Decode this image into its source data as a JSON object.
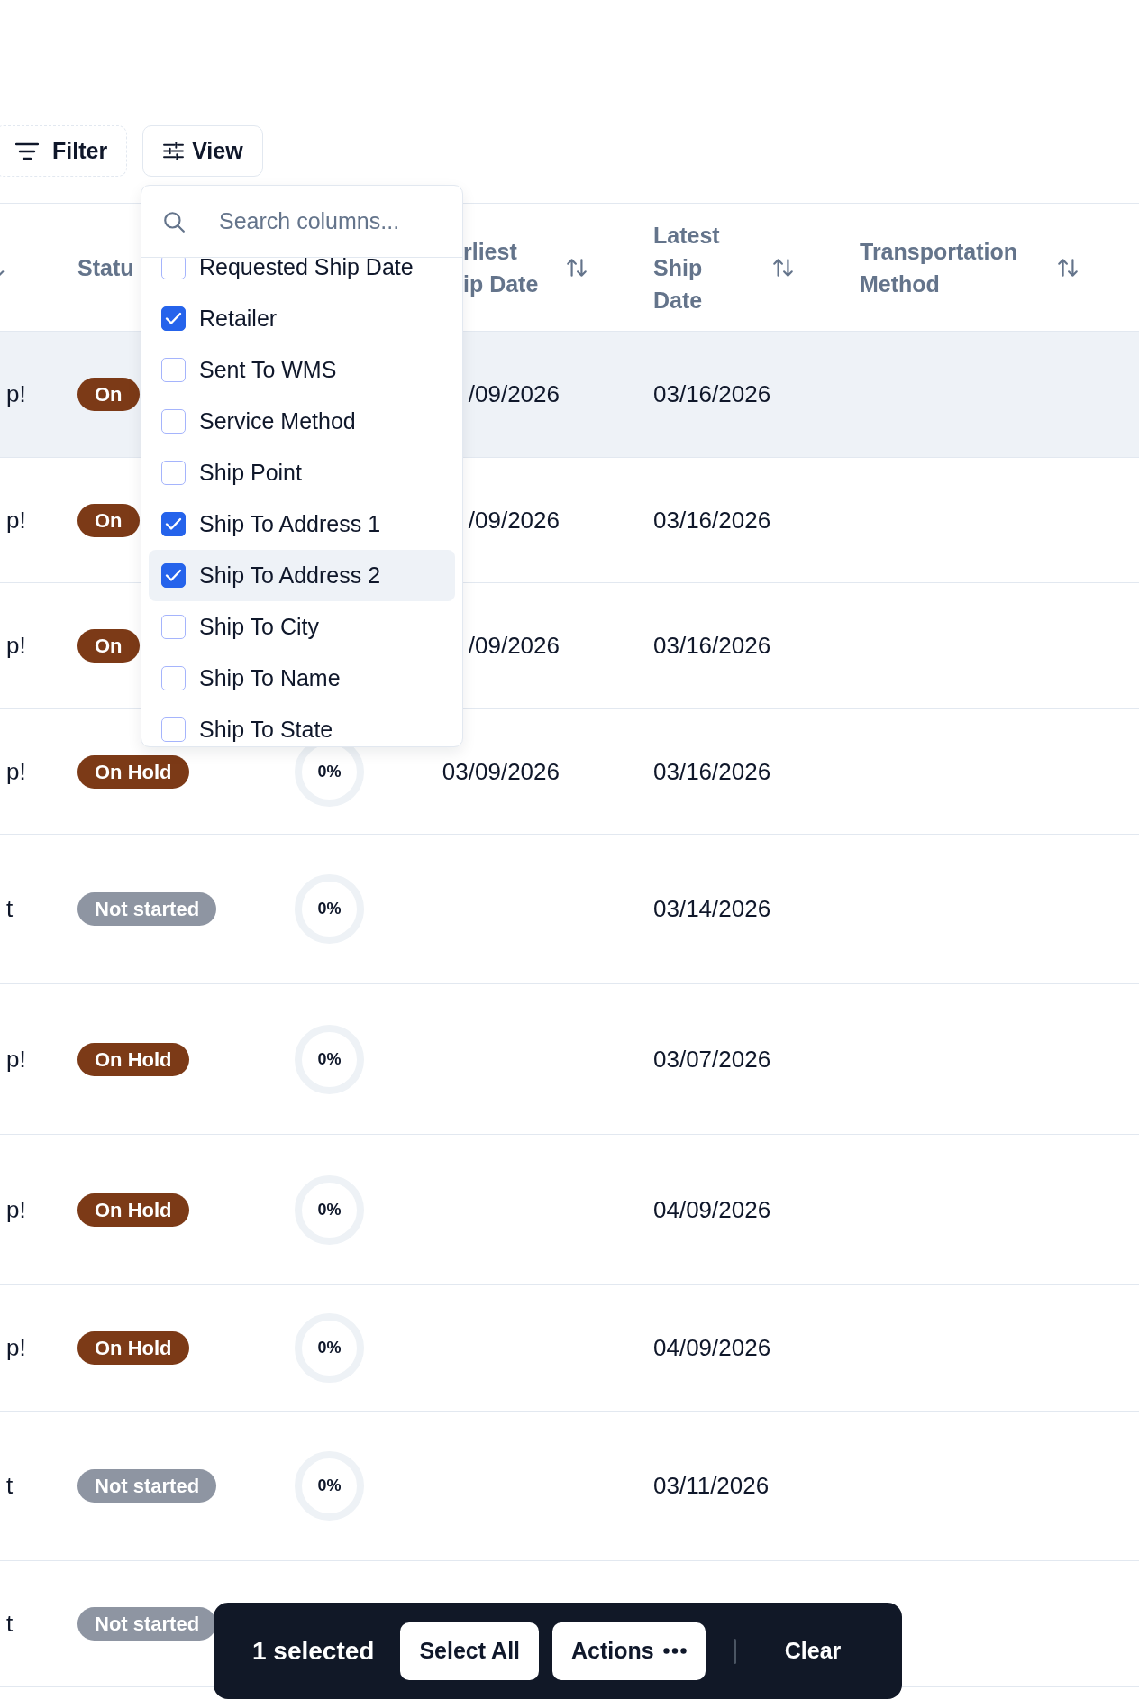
{
  "toolbar": {
    "buttons": [
      {
        "kind": "filter",
        "label": "Filter"
      },
      {
        "kind": "view",
        "label": "View"
      }
    ]
  },
  "table": {
    "columns": [
      {
        "sortable": true
      },
      {
        "label": "Statu"
      },
      {
        "label": "rliest\nip Date",
        "sortable": true
      },
      {
        "label": "Latest Ship Date",
        "sortable": true
      },
      {
        "label": "Transportation Method",
        "sortable": true
      }
    ],
    "rows": [
      {
        "selected": true,
        "column_1": "p!",
        "status": {
          "label": "On",
          "color": "#7c3a17"
        },
        "earliest_ship_date": "/09/2026",
        "latest_ship_date": "03/16/2026"
      },
      {
        "selected": false,
        "column_1": "p!",
        "status": {
          "label": "On",
          "color": "#7c3a17"
        },
        "earliest_ship_date": "/09/2026",
        "latest_ship_date": "03/16/2026"
      },
      {
        "selected": false,
        "column_1": "p!",
        "status": {
          "label": "On",
          "color": "#7c3a17"
        },
        "earliest_ship_date": "/09/2026",
        "latest_ship_date": "03/16/2026"
      },
      {
        "selected": false,
        "column_1": "p!",
        "status": {
          "label": "On Hold",
          "color": "#7c3a17"
        },
        "progress": "0%",
        "earliest_ship_date": "03/09/2026",
        "latest_ship_date": "03/16/2026"
      },
      {
        "selected": false,
        "column_1": "t",
        "status": {
          "label": "Not started",
          "color": "#8e95a2"
        },
        "progress": "0%",
        "latest_ship_date": "03/14/2026"
      },
      {
        "selected": false,
        "column_1": "p!",
        "status": {
          "label": "On Hold",
          "color": "#7c3a17"
        },
        "progress": "0%",
        "latest_ship_date": "03/07/2026"
      },
      {
        "selected": false,
        "column_1": "p!",
        "status": {
          "label": "On Hold",
          "color": "#7c3a17"
        },
        "progress": "0%",
        "latest_ship_date": "04/09/2026"
      },
      {
        "selected": false,
        "column_1": "p!",
        "status": {
          "label": "On Hold",
          "color": "#7c3a17"
        },
        "progress": "0%",
        "latest_ship_date": "04/09/2026"
      },
      {
        "selected": false,
        "column_1": "t",
        "status": {
          "label": "Not started",
          "color": "#8e95a2"
        },
        "progress": "0%",
        "latest_ship_date": "03/11/2026"
      },
      {
        "selected": false,
        "column_1": "t",
        "status": {
          "label": "Not started",
          "color": "#8e95a2"
        }
      }
    ]
  },
  "columns_menu": {
    "search": {
      "placeholder": "Search columns..."
    },
    "items": [
      {
        "label": "Requested Ship Date",
        "checked": false,
        "highlighted": false
      },
      {
        "label": "Retailer",
        "checked": true,
        "highlighted": false
      },
      {
        "label": "Sent To WMS",
        "checked": false,
        "highlighted": false
      },
      {
        "label": "Service Method",
        "checked": false,
        "highlighted": false
      },
      {
        "label": "Ship Point",
        "checked": false,
        "highlighted": false
      },
      {
        "label": "Ship To Address 1",
        "checked": true,
        "highlighted": false
      },
      {
        "label": "Ship To Address 2",
        "checked": true,
        "highlighted": true
      },
      {
        "label": "Ship To City",
        "checked": false,
        "highlighted": false
      },
      {
        "label": "Ship To Name",
        "checked": false,
        "highlighted": false
      },
      {
        "label": "Ship To State",
        "checked": false,
        "highlighted": false
      }
    ]
  },
  "selection_bar": {
    "count": "1 selected",
    "buttons": [
      {
        "kind": "select_all",
        "label": "Select All"
      },
      {
        "kind": "actions",
        "label": "Actions"
      },
      {
        "kind": "clear",
        "label": "Clear"
      }
    ]
  }
}
